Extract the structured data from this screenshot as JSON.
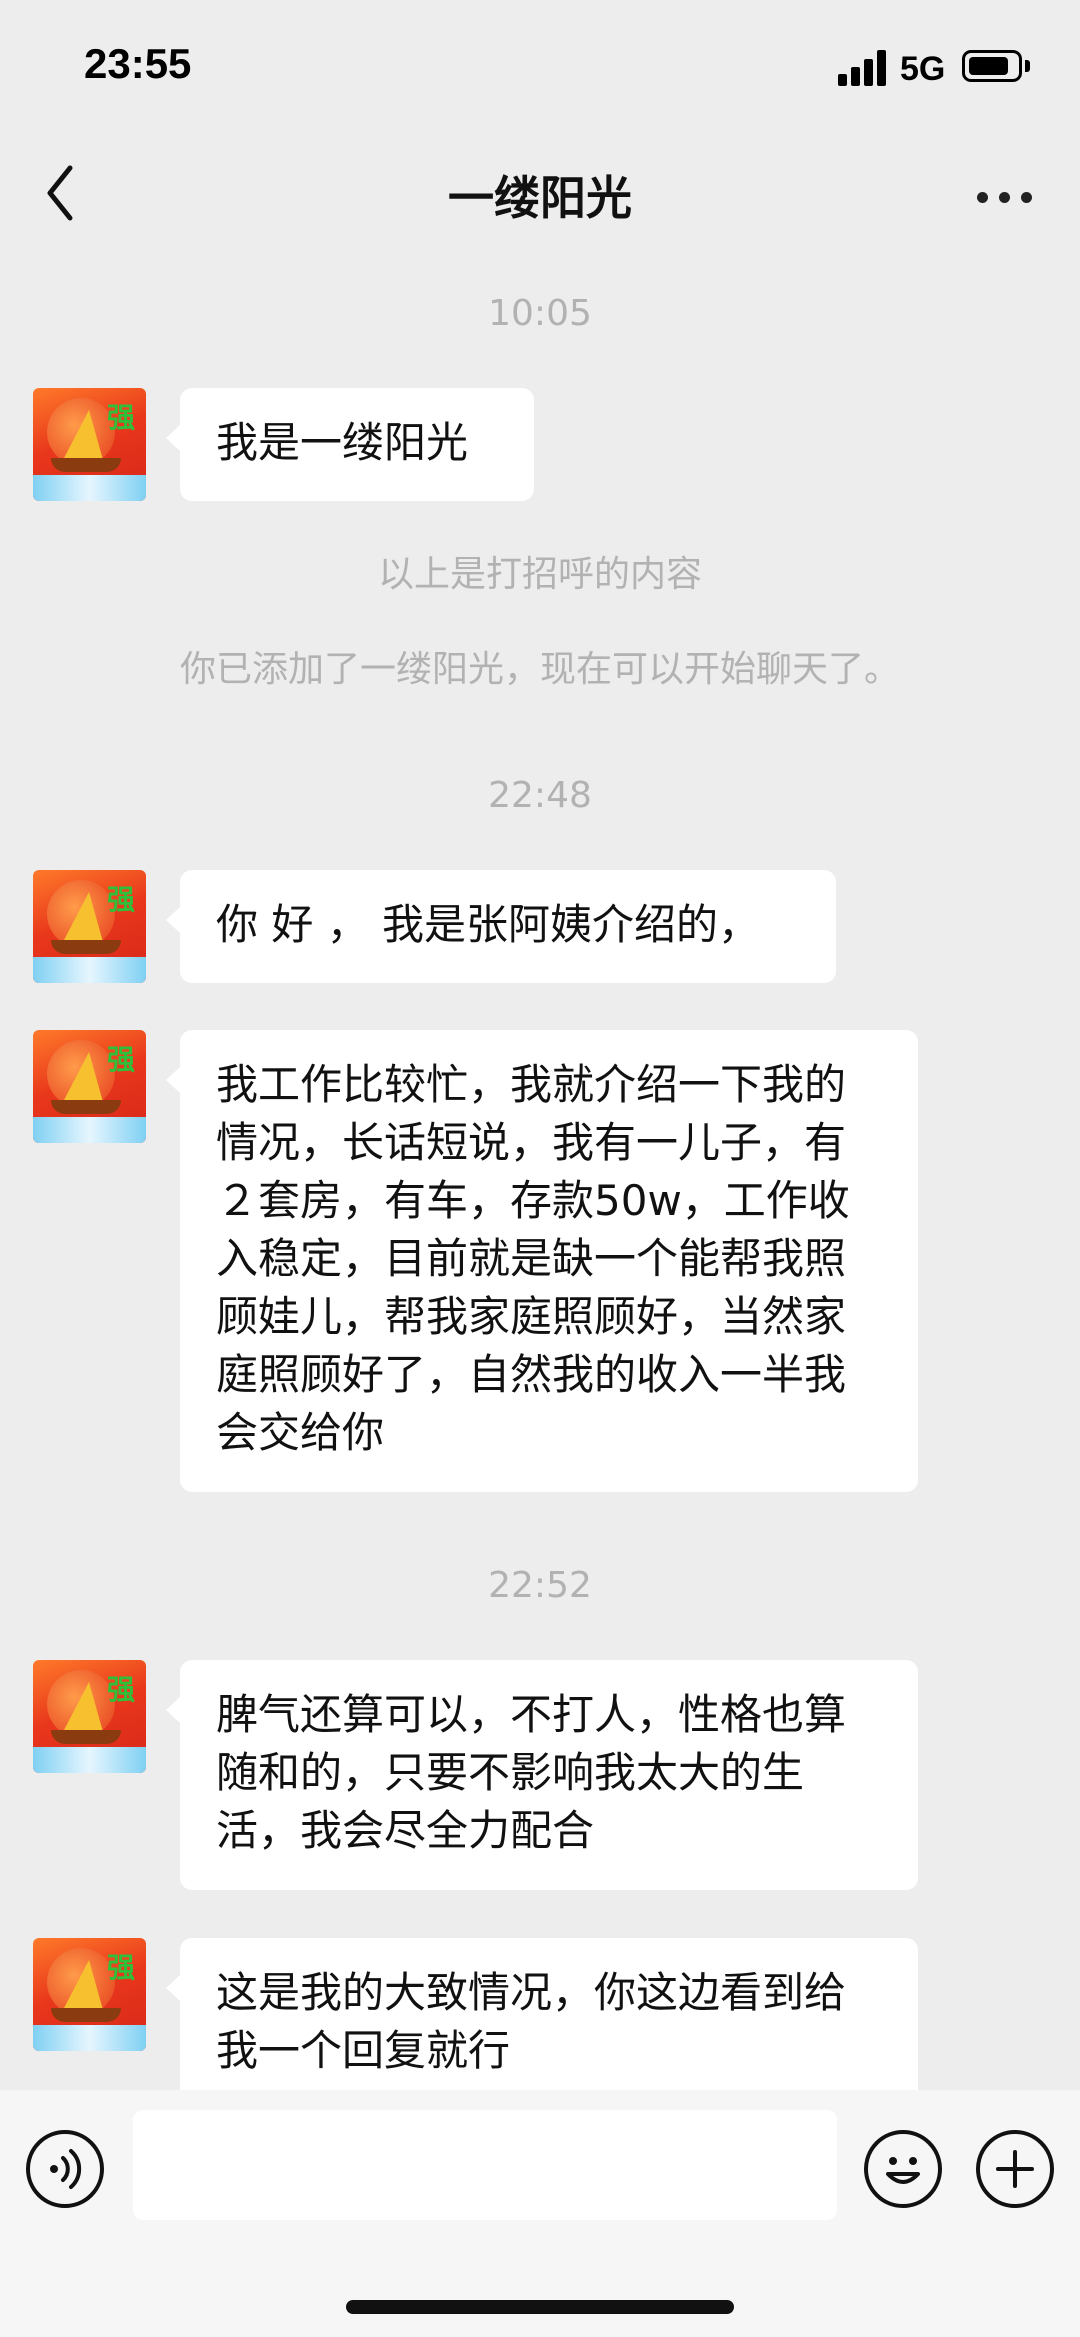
{
  "status_bar": {
    "time": "23:55",
    "network": "5G",
    "battery_level": 0.85
  },
  "header": {
    "title": "一缕阳光",
    "back_icon": "chevron-left-icon",
    "more_icon": "more-dots-icon"
  },
  "chat": {
    "timestamps": [
      "10:05",
      "22:48",
      "22:52"
    ],
    "system_notes": [
      "以上是打招呼的内容",
      "你已添加了一缕阳光，现在可以开始聊天了。"
    ],
    "messages": [
      {
        "text": "我是一缕阳光"
      },
      {
        "text": "你 好 ， 我是张阿姨介绍的，"
      },
      {
        "text": "我工作比较忙，我就介绍一下我的情况，长话短说，我有一儿子，有２套房，有车，存款50w，工作收入稳定，目前就是缺一个能帮我照顾娃儿，帮我家庭照顾好，当然家庭照顾好了，自然我的收入一半我会交给你"
      },
      {
        "text": "脾气还算可以，不打人，性格也算随和的，只要不影响我太大的生活，我会尽全力配合"
      },
      {
        "text": "这是我的大致情况，你这边看到给我一个回复就行"
      }
    ]
  },
  "input_bar": {
    "voice_icon": "voice-icon",
    "emoji_icon": "emoji-icon",
    "plus_icon": "plus-icon",
    "text_value": ""
  },
  "colors": {
    "background": "#ededed",
    "bubble": "#ffffff",
    "meta_text": "#b2b2b2"
  }
}
